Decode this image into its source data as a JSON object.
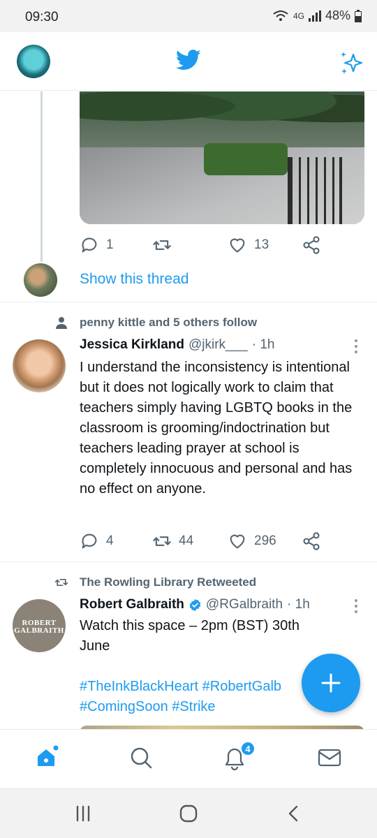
{
  "status_bar": {
    "time": "09:30",
    "network": "4G",
    "battery": "48%"
  },
  "colors": {
    "accent": "#1d9bf0",
    "text": "#0f1419",
    "secondary": "#536471",
    "divider": "#e6ecf0"
  },
  "top_bar": {
    "icons": [
      "profile-avatar",
      "twitter-bird-icon",
      "sparkle-icon"
    ]
  },
  "feed": {
    "tweet_1": {
      "actions": {
        "replies": "1",
        "retweets": "",
        "likes": "13"
      },
      "show_thread": "Show this thread"
    },
    "tweet_2": {
      "social_context": "penny kittle and 5 others follow",
      "name": "Jessica Kirkland",
      "handle": "@jkirk___",
      "time": "· 1h",
      "text": "I understand the inconsistency is intentional but it does not logically work to claim that teachers simply having LGBTQ books in the classroom is grooming/indoctrination but teachers leading prayer at school is completely innocuous and personal and has no effect on anyone.",
      "actions": {
        "replies": "4",
        "retweets": "44",
        "likes": "296"
      }
    },
    "tweet_3": {
      "social_context": "The Rowling Library Retweeted",
      "name": "Robert Galbraith",
      "handle": "@RGalbraith",
      "time": "· 1h",
      "avatar_text": "ROBERT GALBRAITH",
      "text": "Watch this space – 2pm (BST) 30th June",
      "tags_line_1": "#TheInkBlackHeart #RobertGalb",
      "tags_line_2": "#ComingSoon #Strike"
    }
  },
  "bottom_nav": {
    "notifications_badge": "4"
  }
}
